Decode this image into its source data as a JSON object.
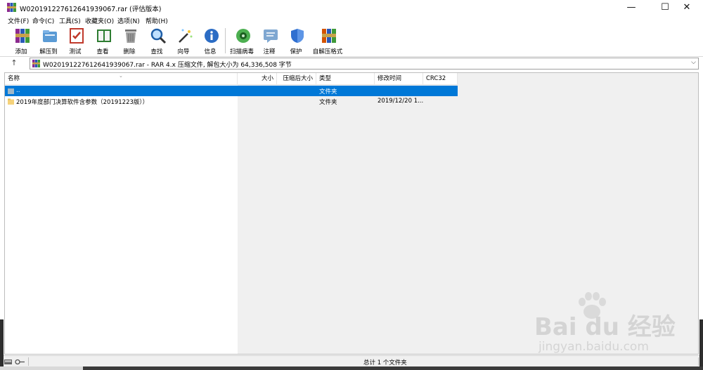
{
  "window": {
    "title": "W020191227612641939067.rar (评估版本)",
    "controls": {
      "minimize": "—",
      "maximize": "☐",
      "close": "✕"
    }
  },
  "menu": [
    "文件(F)",
    "命令(C)",
    "工具(S)",
    "收藏夹(O)",
    "选项(N)",
    "帮助(H)"
  ],
  "toolbar": [
    {
      "label": "添加",
      "icon": "books-add-icon"
    },
    {
      "label": "解压到",
      "icon": "folder-extract-icon"
    },
    {
      "label": "测试",
      "icon": "test-checklist-icon"
    },
    {
      "label": "查看",
      "icon": "book-view-icon"
    },
    {
      "label": "删除",
      "icon": "trash-icon"
    },
    {
      "label": "查找",
      "icon": "magnifier-icon"
    },
    {
      "label": "向导",
      "icon": "wizard-wand-icon"
    },
    {
      "label": "信息",
      "icon": "info-icon"
    },
    {
      "label": "扫描病毒",
      "icon": "virus-scan-icon"
    },
    {
      "label": "注释",
      "icon": "comment-icon"
    },
    {
      "label": "保护",
      "icon": "shield-icon"
    },
    {
      "label": "自解压格式",
      "icon": "sfx-books-icon"
    }
  ],
  "address": {
    "up": "↑",
    "text": "W020191227612641939067.rar - RAR 4.x 压缩文件, 解包大小为 64,336,508 字节",
    "chevron": "⌵"
  },
  "columns": [
    "名称",
    "大小",
    "压缩后大小",
    "类型",
    "修改时间",
    "CRC32"
  ],
  "rows": [
    {
      "name": "..",
      "size": "",
      "packed": "",
      "type": "文件夹",
      "modified": "",
      "crc": "",
      "selected": true
    },
    {
      "name": "2019年度部门决算软件含参数（20191223版））",
      "size": "",
      "packed": "",
      "type": "文件夹",
      "modified": "2019/12/20 1...",
      "crc": "",
      "selected": false
    }
  ],
  "status": {
    "text": "总计 1 个文件夹"
  },
  "watermark": {
    "brand": "Bai du 经验",
    "url": "jingyan.baidu.com"
  },
  "colors": {
    "selection": "#0078d7",
    "folder": "#f5d27a",
    "toolbar_bg": "#ffffff",
    "status_bg": "#f0f0f0"
  }
}
